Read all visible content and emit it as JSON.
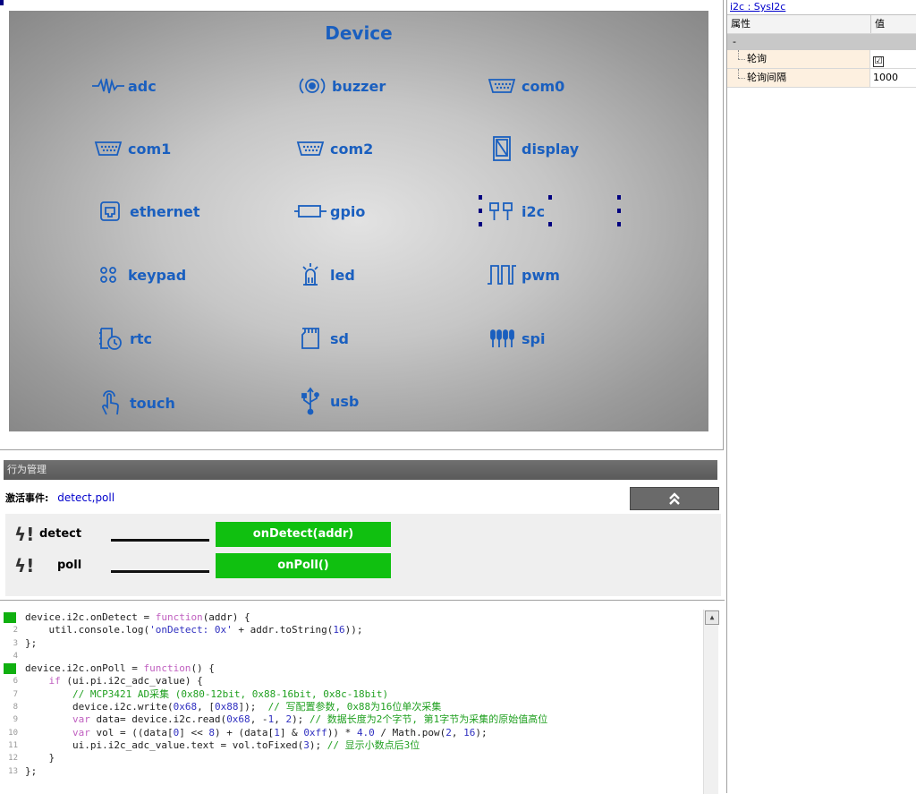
{
  "canvas": {
    "title": "Device",
    "devices": [
      {
        "label": "adc",
        "icon": "waveform-icon"
      },
      {
        "label": "buzzer",
        "icon": "speaker-icon"
      },
      {
        "label": "com0",
        "icon": "serial-port-icon"
      },
      {
        "label": "com1",
        "icon": "serial-port-icon"
      },
      {
        "label": "com2",
        "icon": "serial-port-icon"
      },
      {
        "label": "display",
        "icon": "display-icon"
      },
      {
        "label": "ethernet",
        "icon": "ethernet-icon"
      },
      {
        "label": "gpio",
        "icon": "gpio-icon"
      },
      {
        "label": "i2c",
        "icon": "i2c-icon"
      },
      {
        "label": "keypad",
        "icon": "keypad-icon"
      },
      {
        "label": "led",
        "icon": "led-icon"
      },
      {
        "label": "pwm",
        "icon": "pwm-icon"
      },
      {
        "label": "rtc",
        "icon": "clock-icon"
      },
      {
        "label": "sd",
        "icon": "sd-card-icon"
      },
      {
        "label": "spi",
        "icon": "spi-icon"
      },
      {
        "label": "touch",
        "icon": "touch-icon"
      },
      {
        "label": "usb",
        "icon": "usb-icon"
      }
    ],
    "selected": "i2c",
    "accent_color": "#1a5fbf"
  },
  "properties": {
    "header_link": "i2c : SysI2c",
    "col_name": "属性",
    "col_value": "值",
    "category": "-",
    "rows": [
      {
        "name": "轮询",
        "value": "☑",
        "type": "checkbox",
        "checked": true
      },
      {
        "name": "轮询间隔",
        "value": "1000",
        "type": "text"
      }
    ]
  },
  "behavior": {
    "title": "行为管理",
    "active_label": "激活事件:",
    "active_value": "detect,poll",
    "collapse_icon": "double-chevron-up-icon",
    "collapse_glyph": "⏶",
    "events": [
      {
        "name": "detect",
        "handler": "onDetect(addr)"
      },
      {
        "name": "poll",
        "handler": "onPoll()"
      }
    ],
    "handler_color": "#10c010"
  },
  "editor": {
    "line_numbers": [
      "",
      "2",
      "3",
      "4",
      "",
      "6",
      "7",
      "8",
      "9",
      "10",
      "11",
      "12",
      "13"
    ],
    "lines": [
      "device.i2c.onDetect = function(addr) {",
      "    util.console.log('onDetect: 0x' + addr.toString(16));",
      "};",
      "",
      "device.i2c.onPoll = function() {",
      "    if (ui.pi.i2c_adc_value) {",
      "        // MCP3421 AD采集 (0x80-12bit, 0x88-16bit, 0x8c-18bit)",
      "        device.i2c.write(0x68, [0x88]);  // 写配置参数, 0x88为16位单次采集",
      "        var data= device.i2c.read(0x68, -1, 2); // 数据长度为2个字节, 第1字节为采集的原始值高位",
      "        var vol = ((data[0] << 8) + (data[1] & 0xff)) * 4.0 / Math.pow(2, 16);",
      "        ui.pi.i2c_adc_value.text = vol.toFixed(3); // 显示小数点后3位",
      "    }",
      "};"
    ]
  }
}
